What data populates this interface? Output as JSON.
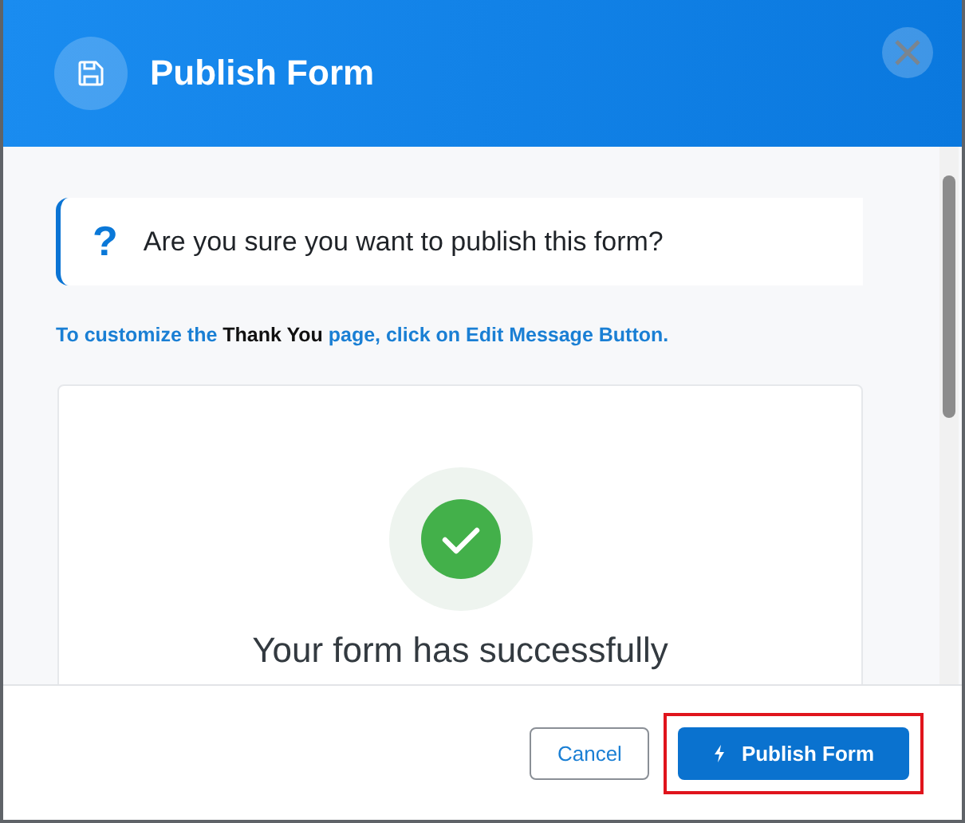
{
  "dialog": {
    "title": "Publish Form"
  },
  "question_icon": "?",
  "question": "Are you sure you want to publish this form?",
  "hint": "To customize the **Thank You** page, click on Edit Message Button.",
  "preview": {
    "message": "Your form has successfully"
  },
  "buttons": [
    {
      "label": "Cancel",
      "kind": "secondary",
      "highlighted": false
    },
    {
      "label": "Publish Form",
      "kind": "primary",
      "highlighted": true
    }
  ]
}
